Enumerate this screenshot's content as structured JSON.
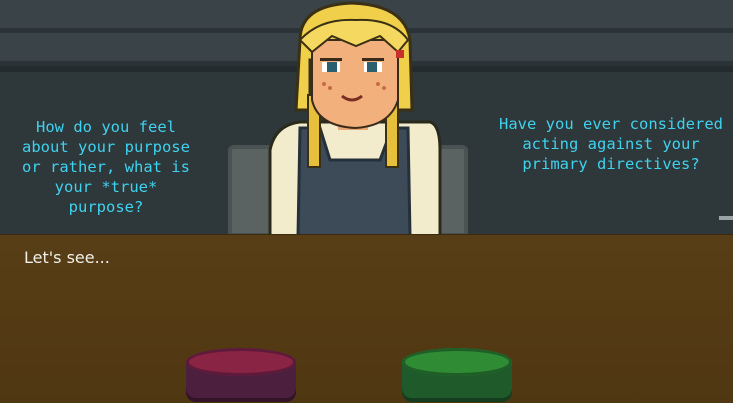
{
  "options": {
    "left": "How do you feel\nabout your purpose\nor rather, what is\nyour *true*\npurpose?",
    "right": "Have you ever considered\nacting against your\nprimary directives?"
  },
  "dialogue": {
    "text": "Let's see..."
  },
  "colors": {
    "option_text": "#3fd2ef",
    "dialogue_text": "#f0efe8",
    "desk": "#583e16",
    "red_button": "#8a2444",
    "green_button": "#2f8c34"
  }
}
